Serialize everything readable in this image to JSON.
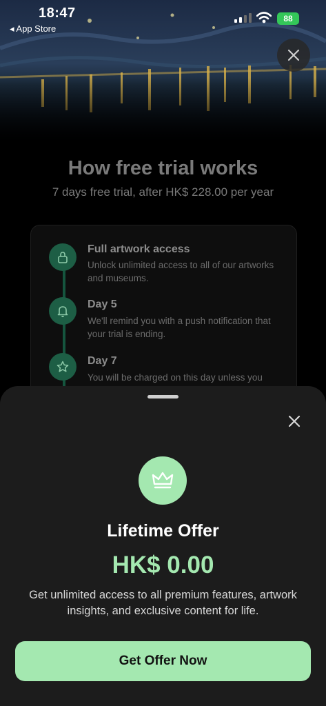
{
  "status_bar": {
    "time": "18:47",
    "back_label": "◂ App Store",
    "battery": "88"
  },
  "trial": {
    "title": "How free trial works",
    "subtitle": "7 days free trial, after HK$ 228.00 per year",
    "steps": [
      {
        "icon": "lock-icon",
        "title": "Full artwork access",
        "desc": "Unlock unlimited access to all of our artworks and museums."
      },
      {
        "icon": "bell-icon",
        "title": "Day 5",
        "desc": "We'll remind you with a push notification that your trial is ending."
      },
      {
        "icon": "star-icon",
        "title": "Day 7",
        "desc": "You will be charged on this day unless you"
      }
    ]
  },
  "offer": {
    "icon": "crown-icon",
    "title": "Lifetime Offer",
    "price": "HK$ 0.00",
    "description": "Get unlimited access to all premium features, artwork insights, and exclusive content for life.",
    "cta_label": "Get Offer Now"
  },
  "colors": {
    "accent": "#a4e8b0",
    "sheet_bg": "#1c1c1c",
    "timeline": "#1d5e45",
    "battery": "#34c759"
  }
}
